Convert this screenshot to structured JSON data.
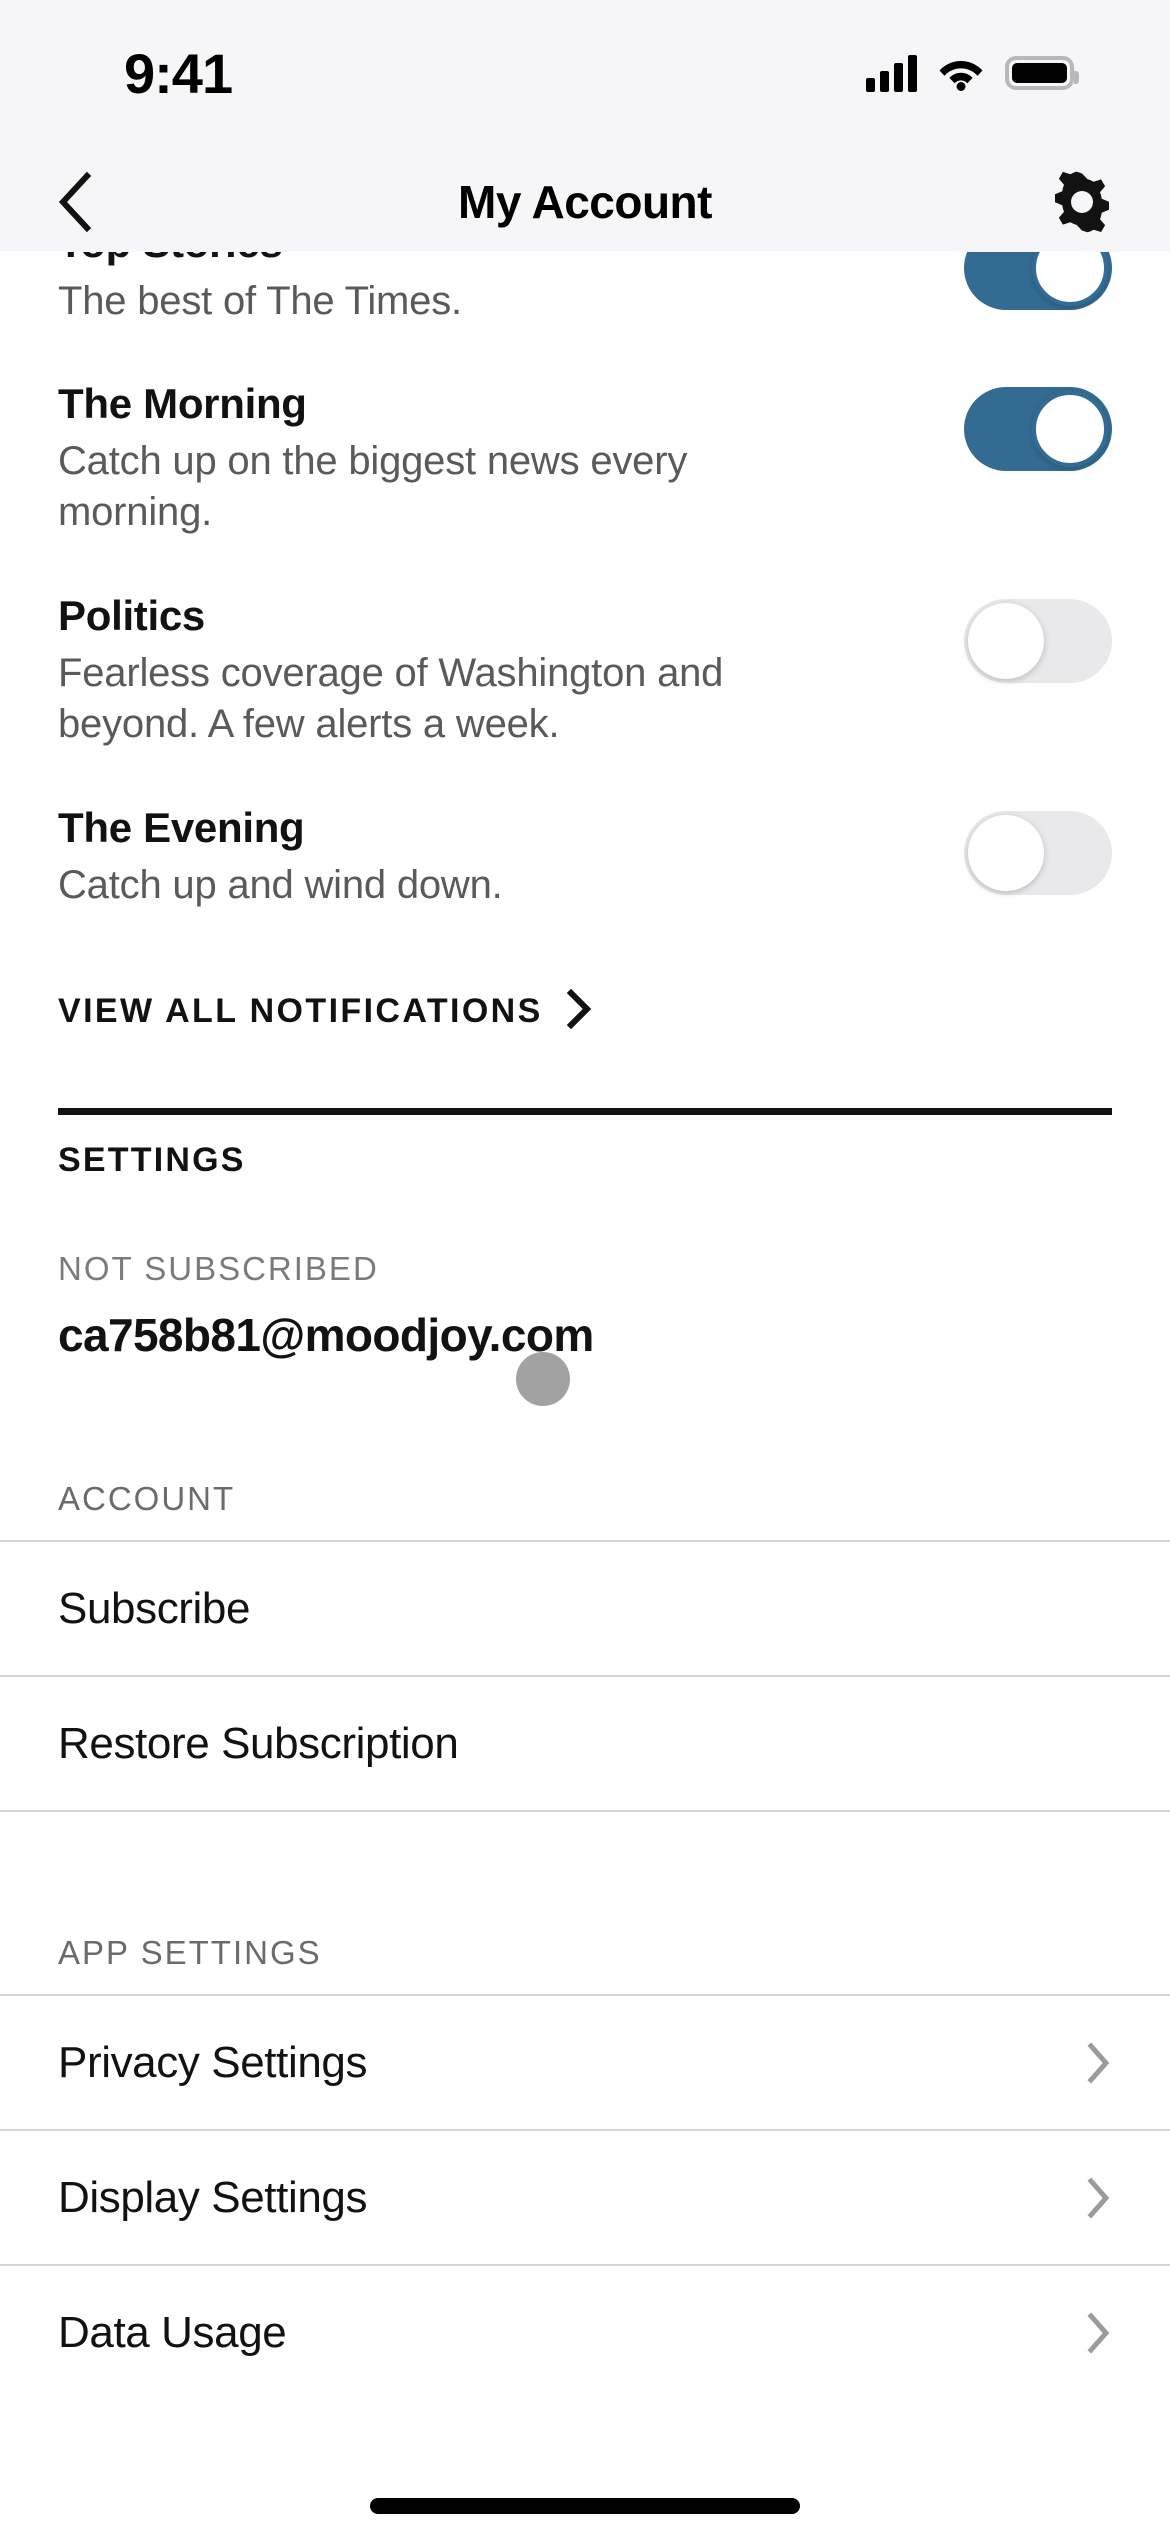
{
  "status_bar": {
    "time": "9:41",
    "cellular_icon": "cellular-bars-icon",
    "wifi_icon": "wifi-icon",
    "battery_icon": "battery-full-icon"
  },
  "nav_bar": {
    "back_icon": "chevron-left-icon",
    "title": "My Account",
    "settings_icon": "gear-icon"
  },
  "notifications": {
    "items": [
      {
        "title": "Top Stories",
        "description": "The best of The Times.",
        "enabled": true
      },
      {
        "title": "The Morning",
        "description": "Catch up on the biggest news every morning.",
        "enabled": true
      },
      {
        "title": "Politics",
        "description": "Fearless coverage of Washington and beyond. A few alerts a week.",
        "enabled": false
      },
      {
        "title": "The Evening",
        "description": "Catch up and wind down.",
        "enabled": false
      }
    ],
    "view_all_label": "VIEW ALL NOTIFICATIONS",
    "view_all_icon": "chevron-right-icon"
  },
  "settings": {
    "heading": "SETTINGS",
    "subscription_status": "NOT SUBSCRIBED",
    "email": "ca758b81@moodjoy.com"
  },
  "account": {
    "group_label": "ACCOUNT",
    "items": [
      {
        "label": "Subscribe",
        "chevron": false
      },
      {
        "label": "Restore Subscription",
        "chevron": false
      }
    ]
  },
  "app_settings": {
    "group_label": "APP SETTINGS",
    "items": [
      {
        "label": "Privacy Settings",
        "chevron": true
      },
      {
        "label": "Display Settings",
        "chevron": true
      },
      {
        "label": "Data Usage",
        "chevron": true
      }
    ]
  },
  "colors": {
    "toggle_on": "#336b92",
    "toggle_off": "#e9e9eb",
    "text_primary": "#121212",
    "text_secondary": "#5a5a5a",
    "status_bar_bg": "#f6f6f8"
  }
}
